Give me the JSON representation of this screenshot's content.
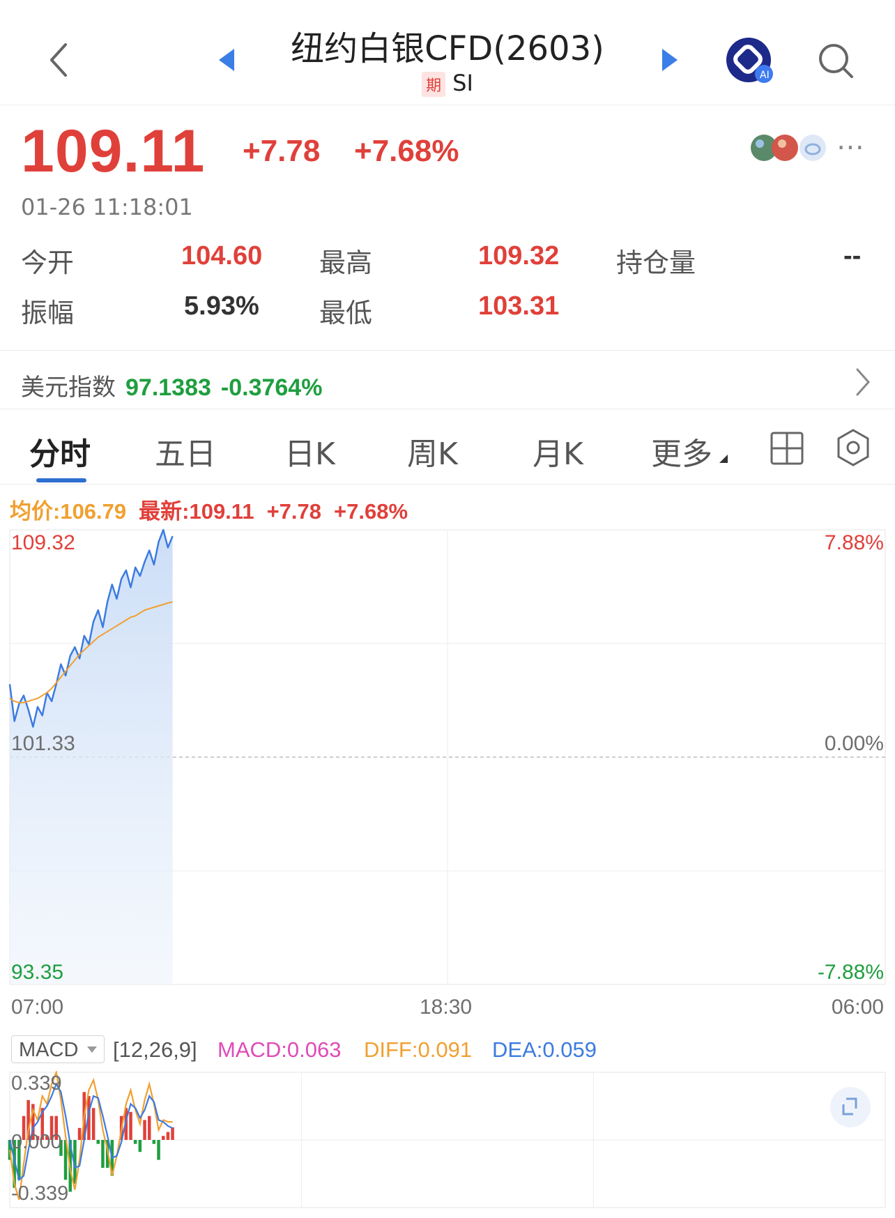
{
  "header": {
    "title": "纽约白银CFD(2603)",
    "badge": "期",
    "symbol": "SI"
  },
  "quote": {
    "price": "109.11",
    "change": "+7.78",
    "change_pct": "+7.68%",
    "timestamp": "01-26 11:18:01"
  },
  "stats": {
    "open_label": "今开",
    "open_value": "104.60",
    "high_label": "最高",
    "high_value": "109.32",
    "oi_label": "持仓量",
    "oi_value": "--",
    "amp_label": "振幅",
    "amp_value": "5.93%",
    "low_label": "最低",
    "low_value": "103.31"
  },
  "usd_index": {
    "label": "美元指数",
    "value": "97.1383",
    "change": "-0.3764%"
  },
  "tabs": [
    "分时",
    "五日",
    "日K",
    "周K",
    "月K",
    "更多"
  ],
  "legend": {
    "avg": "均价:106.79",
    "latest": "最新:109.11",
    "change": "+7.78",
    "change_pct": "+7.68%"
  },
  "colors": {
    "up": "#e0403a",
    "down": "#1f9e3f",
    "price_line": "#3c7be0",
    "avg_line": "#f0a030",
    "accent": "#2f6fd1"
  },
  "chart_data": [
    {
      "type": "line",
      "ylim": [
        93.35,
        109.32
      ],
      "y_ticks_left": [
        "109.32",
        "101.33",
        "93.35"
      ],
      "y_ticks_right": [
        "7.88%",
        "0.00%",
        "-7.88%"
      ],
      "x_ticks": [
        "07:00",
        "18:30",
        "06:00"
      ],
      "series": [
        {
          "values": [
            103.9,
            102.6,
            103.2,
            103.5,
            103.0,
            102.4,
            103.1,
            102.8,
            103.6,
            103.3,
            103.9,
            104.6,
            104.2,
            104.9,
            105.2,
            104.8,
            105.6,
            105.3,
            106.1,
            106.5,
            105.9,
            106.8,
            107.4,
            106.9,
            107.6,
            107.9,
            107.3,
            108.0,
            107.7,
            108.2,
            108.6,
            108.1,
            108.9,
            109.32,
            108.7,
            109.1
          ]
        },
        {
          "values": [
            103.4,
            103.3,
            103.25,
            103.25,
            103.3,
            103.35,
            103.4,
            103.5,
            103.6,
            103.75,
            103.95,
            104.15,
            104.35,
            104.55,
            104.75,
            104.95,
            105.1,
            105.25,
            105.4,
            105.55,
            105.65,
            105.75,
            105.85,
            105.95,
            106.05,
            106.15,
            106.25,
            106.3,
            106.4,
            106.5,
            106.55,
            106.6,
            106.65,
            106.7,
            106.75,
            106.79
          ]
        }
      ]
    },
    {
      "type": "line",
      "ylim": [
        -0.339,
        0.339
      ],
      "y_ticks": [
        "0.339",
        "0.000",
        "-0.339"
      ],
      "series": [
        {
          "name": "DIFF",
          "values": [
            -0.05,
            -0.22,
            -0.3,
            -0.12,
            0.05,
            0.15,
            0.1,
            0.22,
            0.18,
            0.28,
            0.339,
            0.2,
            0.02,
            -0.15,
            -0.25,
            -0.1,
            0.12,
            0.25,
            0.3,
            0.2,
            0.05,
            -0.05,
            -0.18,
            -0.08,
            0.05,
            0.18,
            0.25,
            0.15,
            0.08,
            0.2,
            0.28,
            0.18,
            0.05,
            0.1,
            0.09,
            0.091
          ]
        },
        {
          "name": "DEA",
          "values": [
            0.0,
            -0.1,
            -0.2,
            -0.18,
            -0.05,
            0.06,
            0.09,
            0.14,
            0.17,
            0.22,
            0.28,
            0.24,
            0.12,
            -0.02,
            -0.14,
            -0.13,
            0.0,
            0.14,
            0.22,
            0.21,
            0.12,
            0.02,
            -0.09,
            -0.08,
            -0.01,
            0.1,
            0.18,
            0.16,
            0.11,
            0.15,
            0.22,
            0.19,
            0.1,
            0.09,
            0.07,
            0.059
          ]
        },
        {
          "name": "MACD",
          "values": [
            -0.1,
            -0.24,
            -0.2,
            0.12,
            0.2,
            0.18,
            0.02,
            0.16,
            0.02,
            0.12,
            0.12,
            -0.08,
            -0.2,
            -0.26,
            -0.22,
            0.06,
            0.24,
            0.22,
            0.16,
            -0.02,
            -0.14,
            -0.14,
            -0.18,
            0.0,
            0.12,
            0.16,
            0.14,
            -0.02,
            -0.06,
            0.1,
            0.12,
            -0.02,
            -0.1,
            0.02,
            0.04,
            0.063
          ]
        }
      ],
      "legend": {
        "selector": "MACD",
        "params": "[12,26,9]",
        "macd": "MACD:0.063",
        "diff": "DIFF:0.091",
        "dea": "DEA:0.059"
      }
    }
  ]
}
